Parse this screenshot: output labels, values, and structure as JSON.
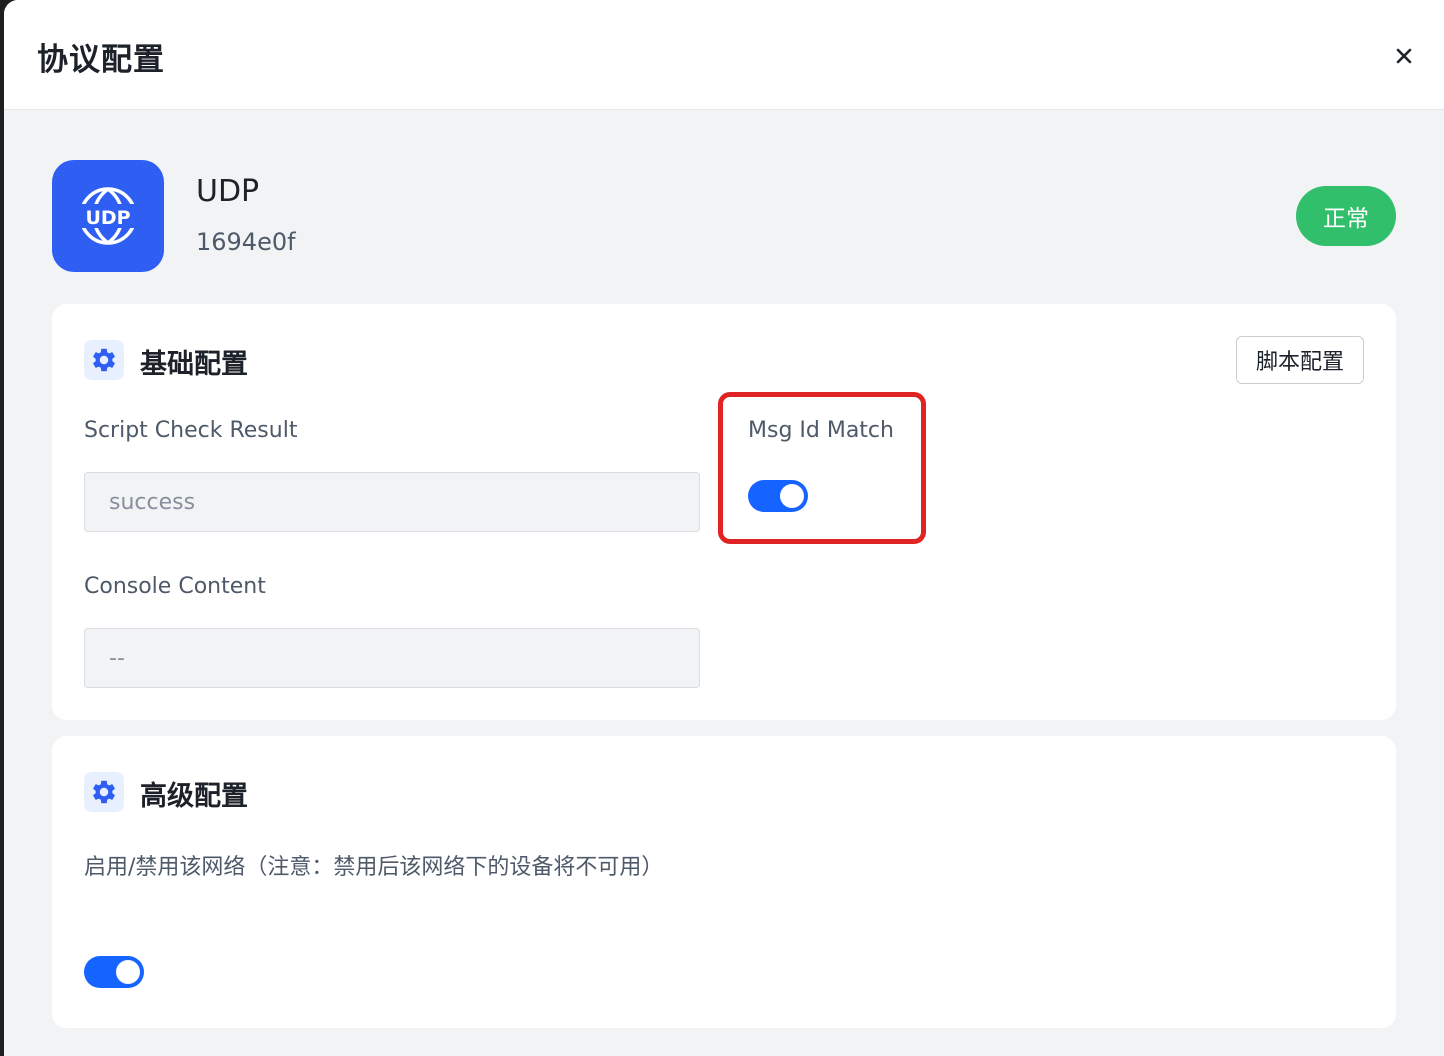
{
  "drawer": {
    "title": "协议配置",
    "close_icon": "close-icon"
  },
  "protocol": {
    "icon": "globe-udp-icon",
    "icon_text": "UDP",
    "name": "UDP",
    "id": "1694e0f",
    "status": "正常",
    "status_color": "#32bf6b",
    "icon_color": "#2f5ff2"
  },
  "basic": {
    "title": "基础配置",
    "icon": "gear-icon",
    "script_button": "脚本配置",
    "script_check_label": "Script Check Result",
    "script_check_value": "success",
    "console_label": "Console Content",
    "console_value": "--",
    "msg_id_label": "Msg Id Match",
    "msg_id_enabled": true
  },
  "advanced": {
    "title": "高级配置",
    "icon": "gear-icon",
    "enable_label": "启用/禁用该网络（注意：禁用后该网络下的设备将不可用）",
    "enable_enabled": true
  },
  "colors": {
    "accent": "#1664ff",
    "highlight": "#e02424"
  }
}
